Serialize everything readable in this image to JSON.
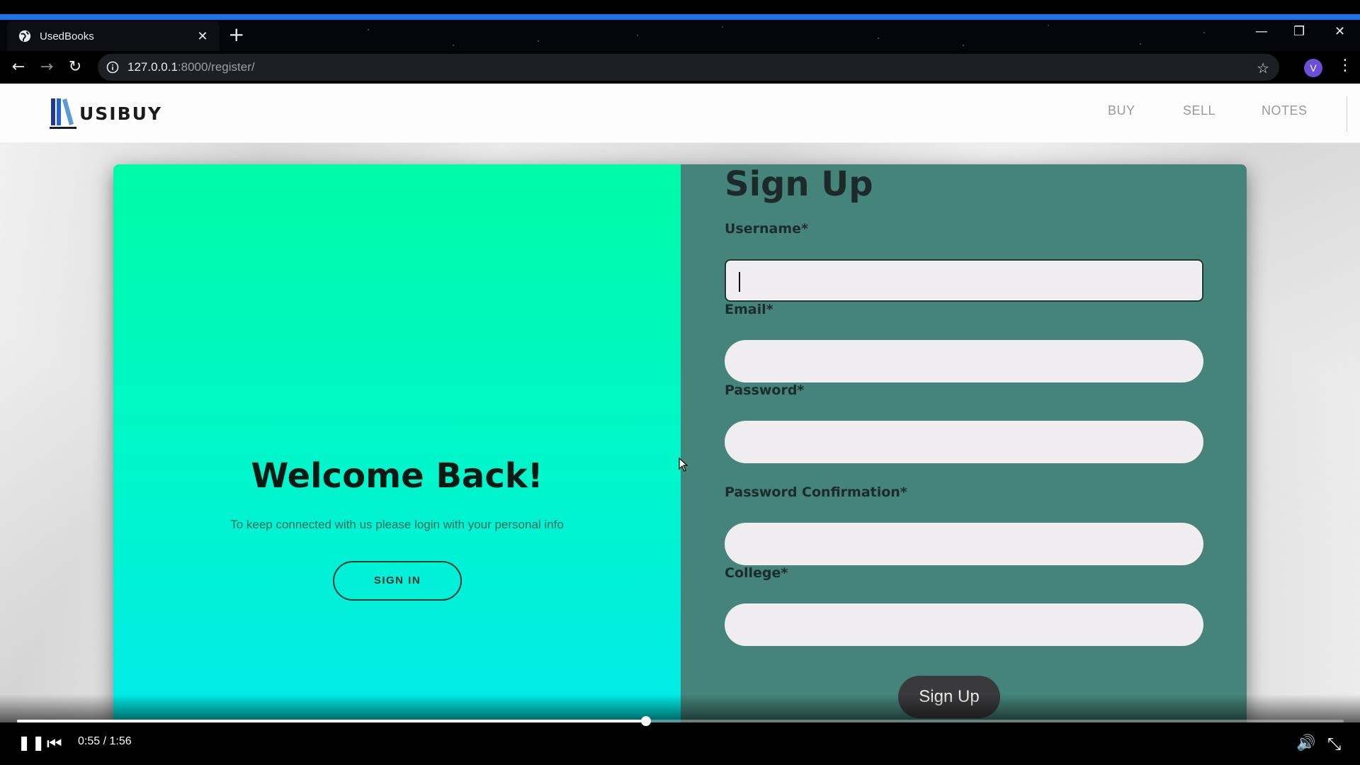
{
  "browser": {
    "tab": {
      "title": "UsedBooks",
      "close": "✕"
    },
    "new_tab": "+",
    "window_controls": {
      "minimize": "—",
      "restore": "❐",
      "close": "✕"
    },
    "nav": {
      "back": "←",
      "forward": "→",
      "reload": "↻"
    },
    "address": {
      "host": "127.0.0.1",
      "path": ":8000/register/"
    },
    "bookmark_icon": "☆",
    "profile_initial": "V",
    "menu": "⋮"
  },
  "site": {
    "logo_text": "USIBUY",
    "nav": [
      {
        "label": "BUY"
      },
      {
        "label": "SELL"
      },
      {
        "label": "NOTES"
      }
    ]
  },
  "welcome": {
    "title": "Welcome Back!",
    "subtitle": "To keep connected with us please login with your personal info",
    "signin_label": "SIGN IN"
  },
  "signup": {
    "title": "Sign Up",
    "fields": [
      {
        "label": "Username*",
        "value": ""
      },
      {
        "label": "Email*",
        "value": ""
      },
      {
        "label": "Password*",
        "value": ""
      },
      {
        "label": "Password Confirmation*",
        "value": ""
      },
      {
        "label": "College*",
        "value": ""
      }
    ],
    "submit_label": "Sign Up"
  },
  "player": {
    "time": "0:55 / 1:56",
    "progress_fraction": 0.474,
    "pause_icon": "❚❚",
    "prev_icon": "⏮",
    "volume_icon": "🔊",
    "fullscreen_exit_icon": "⤡"
  },
  "colors": {
    "welcome_gradient_top": "#00fba7",
    "welcome_gradient_bottom": "#00eaea",
    "signup_panel": "#45847a",
    "chrome_accent": "#1a73e8"
  }
}
